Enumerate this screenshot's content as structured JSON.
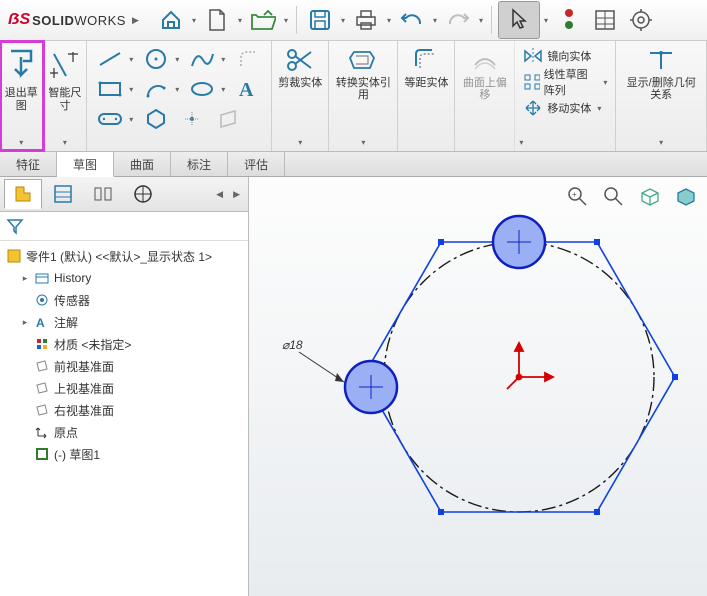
{
  "app": {
    "brand_prefix": "DS",
    "brand_solid": "SOLID",
    "brand_works": "WORKS"
  },
  "ribbon": {
    "exit_sketch": "退出草图",
    "smart_dim": "智能尺寸",
    "trim": "剪裁实体",
    "convert": "转换实体引用",
    "offset": "等距实体",
    "surface_offset": "曲面上偏移",
    "mirror": "镜向实体",
    "linear_pattern": "线性草图阵列",
    "move": "移动实体",
    "display_rel": "显示/删除几何关系"
  },
  "tabs": {
    "features": "特征",
    "sketch": "草图",
    "surfaces": "曲面",
    "annotate": "标注",
    "evaluate": "评估"
  },
  "tree": {
    "root": "零件1 (默认) <<默认>_显示状态 1>",
    "history": "History",
    "sensors": "传感器",
    "annotations": "注解",
    "material": "材质 <未指定>",
    "front": "前视基准面",
    "top": "上视基准面",
    "right": "右视基准面",
    "origin": "原点",
    "sketch1": "(-) 草图1"
  },
  "sketch": {
    "dim_label": "⌀18"
  }
}
